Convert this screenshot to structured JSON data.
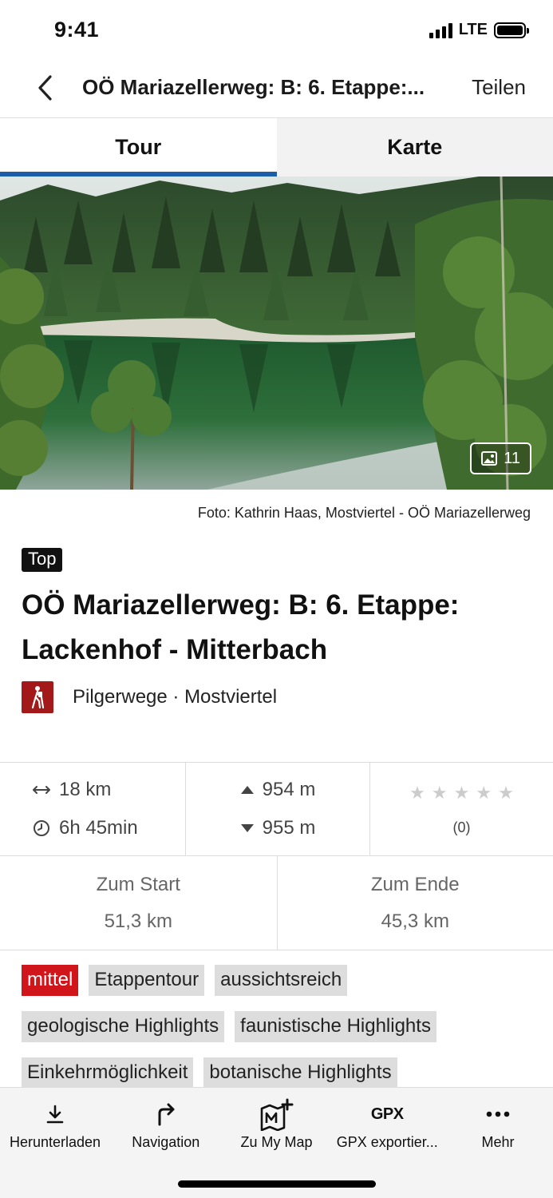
{
  "status_bar": {
    "time": "9:41",
    "network": "LTE"
  },
  "header": {
    "title": "OÖ Mariazellerweg: B: 6. Etappe:...",
    "share_label": "Teilen"
  },
  "tabs": [
    {
      "label": "Tour",
      "active": true
    },
    {
      "label": "Karte",
      "active": false
    }
  ],
  "hero": {
    "photo_count": "11",
    "caption": "Foto: Kathrin Haas, Mostviertel - OÖ Mariazellerweg"
  },
  "tour": {
    "badge": "Top",
    "title": "OÖ Mariazellerweg: B: 6. Etappe: Lackenhof - Mitterbach",
    "category": "Pilgerwege · Mostviertel"
  },
  "stats": {
    "distance": "18 km",
    "duration": "6h 45min",
    "ascent": "954 m",
    "descent": "955 m",
    "rating_stars": 0,
    "rating_count": "(0)"
  },
  "distances": {
    "to_start_label": "Zum Start",
    "to_start_value": "51,3 km",
    "to_end_label": "Zum Ende",
    "to_end_value": "45,3 km"
  },
  "tags": [
    "mittel",
    "Etappentour",
    "aussichtsreich",
    "geologische Highlights",
    "faunistische Highlights",
    "Einkehrmöglichkeit",
    "botanische Highlights"
  ],
  "bottom_bar": {
    "items": [
      {
        "label": "Herunterladen",
        "icon": "download-icon"
      },
      {
        "label": "Navigation",
        "icon": "turn-right-icon"
      },
      {
        "label": "Zu My Map",
        "icon": "add-to-map-icon"
      },
      {
        "label": "GPX exportier...",
        "icon": "gpx-icon",
        "icon_text": "GPX"
      },
      {
        "label": "Mehr",
        "icon": "more-icon"
      }
    ]
  },
  "colors": {
    "accent": "#1b5fa8",
    "level_tag": "#d0151b",
    "category": "#a31818"
  }
}
